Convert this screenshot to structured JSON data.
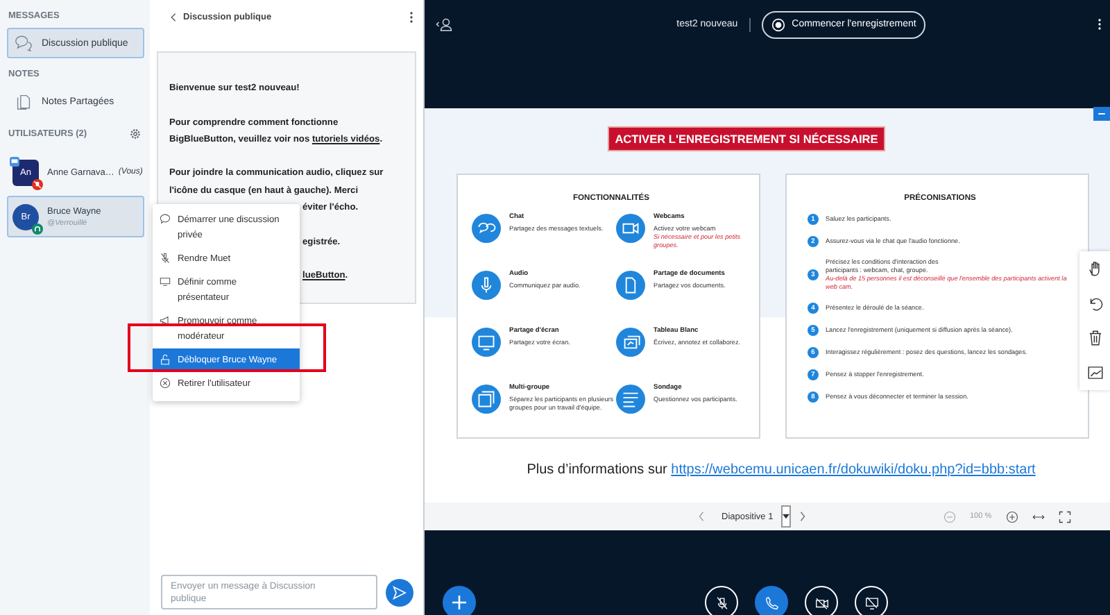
{
  "sidebar": {
    "messages_header": "MESSAGES",
    "chats": [
      {
        "label": "Discussion publique",
        "selected": true
      }
    ],
    "notes_header": "NOTES",
    "notes": [
      {
        "label": "Notes Partagées"
      }
    ],
    "users_header": "UTILISATEURS (2)",
    "users": [
      {
        "initials": "An",
        "name": "Anne Garnava…",
        "you_tag": "(Vous)",
        "selected": false,
        "color": "#1d2a6e",
        "muted": true,
        "presenter": true
      },
      {
        "initials": "Br",
        "name": "Bruce Wayne",
        "status": "@Verrouillé",
        "selected": true,
        "color": "#1f4fa0",
        "muted": false,
        "presenter": false
      }
    ]
  },
  "chat": {
    "title": "Discussion publique",
    "lines": [
      {
        "kind": "full",
        "text": "Bienvenue sur **test2 nouveau**!"
      },
      {
        "kind": "gap"
      },
      {
        "kind": "full",
        "text": "Pour comprendre comment fonctionne"
      },
      {
        "kind": "full",
        "text": "BigBlueButton, veuillez voir nos ",
        "link": "tutoriels vidéos",
        "after": "."
      },
      {
        "kind": "gap"
      },
      {
        "kind": "full",
        "text": "Pour joindre la communication audio, cliquez sur"
      },
      {
        "kind": "full",
        "text": "l'icône du casque (en haut à gauche). **Merci**"
      },
      {
        "kind": "cut",
        "text": "éviter l'écho."
      },
      {
        "kind": "gap"
      },
      {
        "kind": "cut",
        "text": "egistrée."
      },
      {
        "kind": "gap"
      },
      {
        "kind": "cut",
        "link": "lueButton",
        "after": "."
      }
    ],
    "placeholder": "Envoyer un message à Discussion publique"
  },
  "user_menu": [
    {
      "kind": "chat",
      "label": "Démarrer une discussion privée",
      "selected": false
    },
    {
      "kind": "mic",
      "label": "Rendre Muet",
      "selected": false
    },
    {
      "kind": "screen",
      "label": "Définir comme présentateur",
      "selected": false
    },
    {
      "kind": "promote",
      "label": "Promouvoir comme modérateur",
      "selected": false
    },
    {
      "kind": "unlock",
      "label": "Débloquer Bruce Wayne",
      "selected": true
    },
    {
      "kind": "remove",
      "label": "Retirer l'utilisateur",
      "selected": false
    }
  ],
  "topbar": {
    "meeting_title": "test2 nouveau",
    "record_button": "Commencer l'enregistrement"
  },
  "slide": {
    "banner": "ACTIVER L'ENREGISTREMENT SI NÉCESSAIRE",
    "features_title": "FONCTIONNALITÉS",
    "features": [
      {
        "kind": "chat",
        "title": "Chat",
        "text": "Partagez des messages textuels."
      },
      {
        "kind": "webcam",
        "title": "Webcams",
        "text": "Activez votre webcam",
        "note": "Si nécessaire et pour les petits groupes."
      },
      {
        "kind": "mic",
        "title": "Audio",
        "text": "Communiquez par audio."
      },
      {
        "kind": "doc",
        "title": "Partage de documents",
        "text": "Partagez vos documents."
      },
      {
        "kind": "screen",
        "title": "Partage d'écran",
        "text": "Partagez votre écran."
      },
      {
        "kind": "board",
        "title": "Tableau Blanc",
        "text": "Écrivez, annotez et collaborez."
      },
      {
        "kind": "groups",
        "title": "Multi-groupe",
        "text": "Séparez les participants en plusieurs groupes pour un travail d'équipe."
      },
      {
        "kind": "poll",
        "title": "Sondage",
        "text": "Questionnez vos participants."
      }
    ],
    "tips_title": "PRÉCONISATIONS",
    "tips": [
      {
        "number": "1",
        "text": "Saluez les participants."
      },
      {
        "number": "2",
        "text": "Assurez-vous via le chat que l'audio fonctionne."
      },
      {
        "number": "3",
        "text": "Précisez les conditions d'interaction des participants : webcam, chat, groupe.",
        "note": "Au-delà de 15 personnes il est déconseillé que l'ensemble des participants activent la web cam."
      },
      {
        "number": "4",
        "text": "Présentez le déroulé de la séance."
      },
      {
        "number": "5",
        "text": "Lancez l'enregistrement (uniquement si diffusion après la séance)."
      },
      {
        "number": "6",
        "text": "Interagissez régulièrement : posez des questions, lancez les sondages."
      },
      {
        "number": "7",
        "text": "Pensez à stopper l'enregistrement."
      },
      {
        "number": "8",
        "text": "Pensez à vous déconnecter et terminer la session."
      }
    ],
    "info_text": "Plus d’informations sur ",
    "info_link": "https://webcemu.unicaen.fr/dokuwiki/doku.php?id=bbb:start"
  },
  "slide_toolbar": {
    "slide_label": "Diapositive 1",
    "zoom": "100 %"
  },
  "actions": [
    {
      "kind": "mic-off",
      "active": false
    },
    {
      "kind": "phone",
      "active": true
    },
    {
      "kind": "camera-off",
      "active": false
    },
    {
      "kind": "screen",
      "active": false
    }
  ]
}
